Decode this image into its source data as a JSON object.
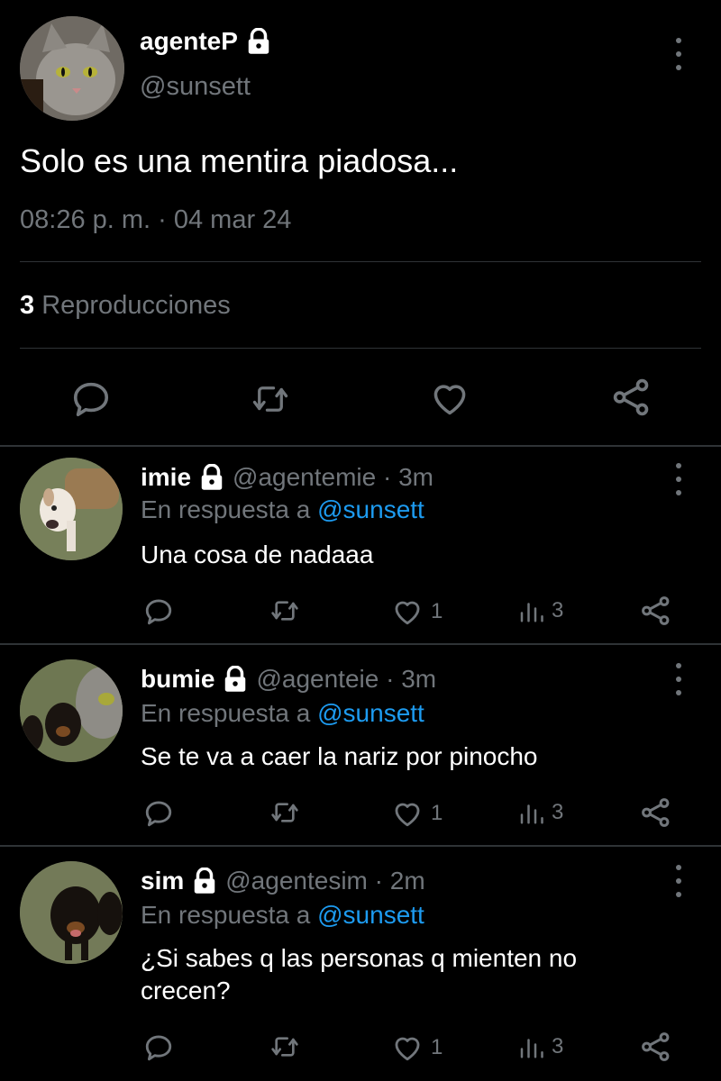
{
  "main_tweet": {
    "name": "agenteP",
    "handle": "@sunsett",
    "text": "Solo es una mentira piadosa...",
    "timestamp": "08:26 p. m. · 04 mar 24",
    "views_count": "3",
    "views_label": "Reproducciones",
    "actions": [
      "reply-icon",
      "retweet-icon",
      "like-icon",
      "share-icon"
    ]
  },
  "replies": [
    {
      "name": "imie",
      "handle": "@agentemie · 3m",
      "reply_prefix": "En respuesta a",
      "reply_to": "@sunsett",
      "text": "Una cosa de nadaaa",
      "likes": "1",
      "views": "3"
    },
    {
      "name": "bumie",
      "handle": "@agenteie · 3m",
      "reply_prefix": "En respuesta a",
      "reply_to": "@sunsett",
      "text": "Se te va a caer la nariz por pinocho",
      "likes": "1",
      "views": "3"
    },
    {
      "name": "sim",
      "handle": "@agentesim · 2m",
      "reply_prefix": "En respuesta a",
      "reply_to": "@sunsett",
      "text": "¿Si sabes q las personas q mienten no crecen?",
      "likes": "1",
      "views": "3"
    }
  ],
  "colors": {
    "background": "#000000",
    "muted": "#71767b",
    "link": "#1d9bf0",
    "divider": "#2f3336"
  }
}
